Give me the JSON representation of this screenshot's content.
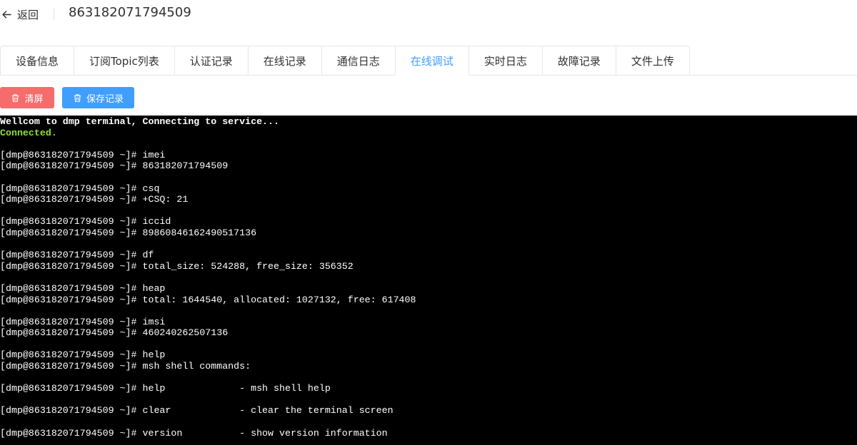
{
  "header": {
    "back_label": "返回",
    "device_id": "863182071794509"
  },
  "tabs": [
    {
      "label": "设备信息"
    },
    {
      "label": "订阅Topic列表"
    },
    {
      "label": "认证记录"
    },
    {
      "label": "在线记录"
    },
    {
      "label": "通信日志"
    },
    {
      "label": "在线调试",
      "active": true
    },
    {
      "label": "实时日志"
    },
    {
      "label": "故障记录"
    },
    {
      "label": "文件上传"
    }
  ],
  "actions": {
    "clear_label": "清屏",
    "save_label": "保存记录"
  },
  "colors": {
    "accent": "#409eff",
    "danger": "#f56c6c",
    "terminal_bg": "#000000",
    "terminal_fg": "#ffffff",
    "terminal_success": "#8ae234"
  },
  "terminal": {
    "lines": [
      {
        "text": "Wellcom to dmp terminal, Connecting to service...",
        "style": "bold"
      },
      {
        "text": "Connected.",
        "style": "green"
      },
      {
        "text": ""
      },
      {
        "text": "[dmp@863182071794509 ~]# imei"
      },
      {
        "text": "[dmp@863182071794509 ~]# 863182071794509"
      },
      {
        "text": ""
      },
      {
        "text": "[dmp@863182071794509 ~]# csq"
      },
      {
        "text": "[dmp@863182071794509 ~]# +CSQ: 21"
      },
      {
        "text": ""
      },
      {
        "text": "[dmp@863182071794509 ~]# iccid"
      },
      {
        "text": "[dmp@863182071794509 ~]# 89860846162490517136"
      },
      {
        "text": ""
      },
      {
        "text": "[dmp@863182071794509 ~]# df"
      },
      {
        "text": "[dmp@863182071794509 ~]# total_size: 524288, free_size: 356352"
      },
      {
        "text": ""
      },
      {
        "text": "[dmp@863182071794509 ~]# heap"
      },
      {
        "text": "[dmp@863182071794509 ~]# total: 1644540, allocated: 1027132, free: 617408"
      },
      {
        "text": ""
      },
      {
        "text": "[dmp@863182071794509 ~]# imsi"
      },
      {
        "text": "[dmp@863182071794509 ~]# 460240262507136"
      },
      {
        "text": ""
      },
      {
        "text": "[dmp@863182071794509 ~]# help"
      },
      {
        "text": "[dmp@863182071794509 ~]# msh shell commands:"
      },
      {
        "text": ""
      },
      {
        "text": "[dmp@863182071794509 ~]# help             - msh shell help"
      },
      {
        "text": ""
      },
      {
        "text": "[dmp@863182071794509 ~]# clear            - clear the terminal screen"
      },
      {
        "text": ""
      },
      {
        "text": "[dmp@863182071794509 ~]# version          - show version information"
      }
    ]
  }
}
